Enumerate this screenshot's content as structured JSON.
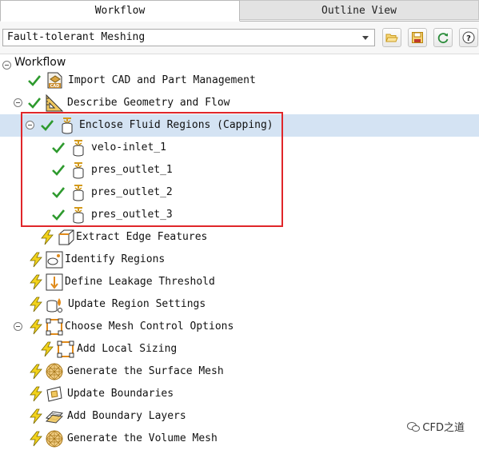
{
  "tabs": [
    {
      "label": "Workflow",
      "active": true
    },
    {
      "label": "Outline View",
      "active": false
    }
  ],
  "toolbar": {
    "workflow_select_value": "Fault-tolerant Meshing",
    "buttons": [
      "open-folder-icon",
      "save-icon",
      "refresh-icon",
      "help-icon"
    ]
  },
  "tree": {
    "root_label": "Workflow",
    "items": [
      {
        "label": "Import CAD and Part Management",
        "status": "done",
        "icon": "cad-import-icon"
      },
      {
        "label": "Describe Geometry and Flow",
        "status": "done",
        "icon": "geometry-ruler-icon"
      },
      {
        "label": "Enclose Fluid Regions (Capping)",
        "status": "done",
        "icon": "capping-icon",
        "selected": true
      },
      {
        "label": "velo-inlet_1",
        "status": "done",
        "icon": "capping-icon"
      },
      {
        "label": "pres_outlet_1",
        "status": "done",
        "icon": "capping-icon"
      },
      {
        "label": "pres_outlet_2",
        "status": "done",
        "icon": "capping-icon"
      },
      {
        "label": "pres_outlet_3",
        "status": "done",
        "icon": "capping-icon"
      },
      {
        "label": "Extract Edge Features",
        "status": "pending",
        "icon": "edge-features-icon"
      },
      {
        "label": "Identify Regions",
        "status": "pending",
        "icon": "regions-icon"
      },
      {
        "label": "Define Leakage Threshold",
        "status": "pending",
        "icon": "leakage-icon"
      },
      {
        "label": "Update Region Settings",
        "status": "pending",
        "icon": "region-settings-icon"
      },
      {
        "label": "Choose Mesh Control Options",
        "status": "pending",
        "icon": "mesh-control-icon"
      },
      {
        "label": "Add Local Sizing",
        "status": "pending",
        "icon": "local-sizing-icon"
      },
      {
        "label": "Generate the Surface Mesh",
        "status": "pending",
        "icon": "surface-mesh-icon"
      },
      {
        "label": "Update Boundaries",
        "status": "pending",
        "icon": "boundaries-icon"
      },
      {
        "label": "Add Boundary Layers",
        "status": "pending",
        "icon": "boundary-layers-icon"
      },
      {
        "label": "Generate the Volume Mesh",
        "status": "pending",
        "icon": "volume-mesh-icon"
      }
    ]
  },
  "watermark": "CFD之道",
  "colors": {
    "done": "#2e9a2e",
    "pending": "#f2d21b",
    "highlight": "#e0262a",
    "selected_row": "#d4e3f3"
  }
}
